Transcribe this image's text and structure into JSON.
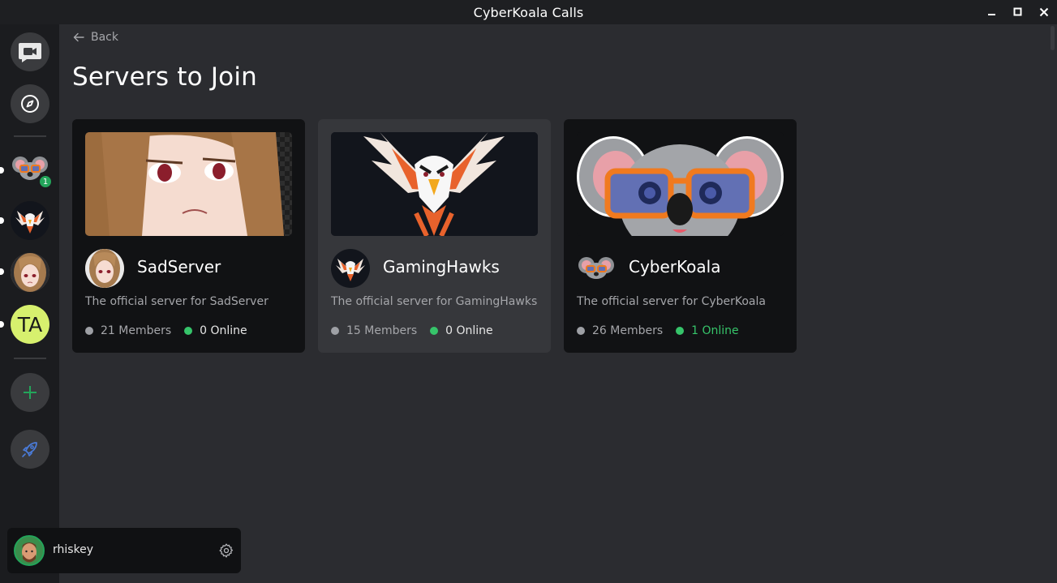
{
  "window": {
    "title": "CyberKoala Calls",
    "controls": [
      "minimize-icon",
      "maximize-icon",
      "close-icon"
    ]
  },
  "sidebar": {
    "top_buttons": [
      {
        "name": "video-call-icon"
      },
      {
        "name": "compass-icon"
      }
    ],
    "servers": [
      {
        "name": "CyberKoala",
        "badge": "1"
      },
      {
        "name": "GamingHawks"
      },
      {
        "name": "SadServer"
      },
      {
        "name": "TA",
        "initials": "TA",
        "color": "#d7f06e"
      }
    ],
    "bottom_buttons": [
      {
        "name": "add-server-icon",
        "color": "#23a55a"
      },
      {
        "name": "rocket-icon",
        "color": "#4a7bd8"
      }
    ]
  },
  "main": {
    "back_label": "Back",
    "title": "Servers to Join",
    "cards": [
      {
        "name": "SadServer",
        "description": "The official server for SadServer",
        "members": "21 Members",
        "online": "0 Online"
      },
      {
        "name": "GamingHawks",
        "description": "The official server for GamingHawks",
        "members": "15 Members",
        "online": "0 Online"
      },
      {
        "name": "CyberKoala",
        "description": "The official server for CyberKoala",
        "members": "26 Members",
        "online": "1 Online"
      }
    ]
  },
  "user": {
    "name": "rhiskey",
    "status_color": "#23a55a"
  },
  "colors": {
    "online": "#36c46a",
    "offline_dot": "#9ea0a5",
    "accent_green": "#23a55a"
  }
}
